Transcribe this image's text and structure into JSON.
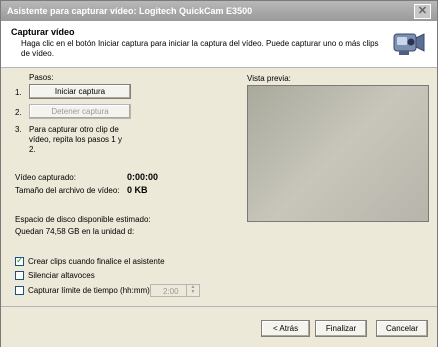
{
  "window": {
    "title": "Asistente para capturar vídeo: Logitech QuickCam E3500",
    "close_glyph": "✕"
  },
  "header": {
    "title": "Capturar vídeo",
    "description": "Haga clic en el botón Iniciar captura para iniciar la captura del vídeo. Puede capturar uno o más clips de vídeo."
  },
  "steps": {
    "label": "Pasos:",
    "n1": "1.",
    "start_button": "Iniciar captura",
    "n2": "2.",
    "stop_button": "Detener captura",
    "n3": "3.",
    "step3_text": "Para capturar otro clip de vídeo, repita los pasos 1 y 2."
  },
  "stats": {
    "captured_label": "Vídeo capturado:",
    "captured_value": "0:00:00",
    "size_label": "Tamaño del archivo de vídeo:",
    "size_value": "0 KB",
    "disk_label": "Espacio de disco disponible estimado:",
    "disk_value": "Quedan 74,58 GB en la unidad d:"
  },
  "preview": {
    "label": "Vista previa:"
  },
  "options": {
    "create_clips": {
      "label": "Crear clips cuando finalice el asistente",
      "checked": true
    },
    "mute": {
      "label": "Silenciar altavoces",
      "checked": false
    },
    "time_limit": {
      "label": "Capturar límite de tiempo (hh:mm):",
      "checked": false,
      "value": "2:00"
    }
  },
  "footer": {
    "back": "< Atrás",
    "finish": "Finalizar",
    "cancel": "Cancelar"
  }
}
